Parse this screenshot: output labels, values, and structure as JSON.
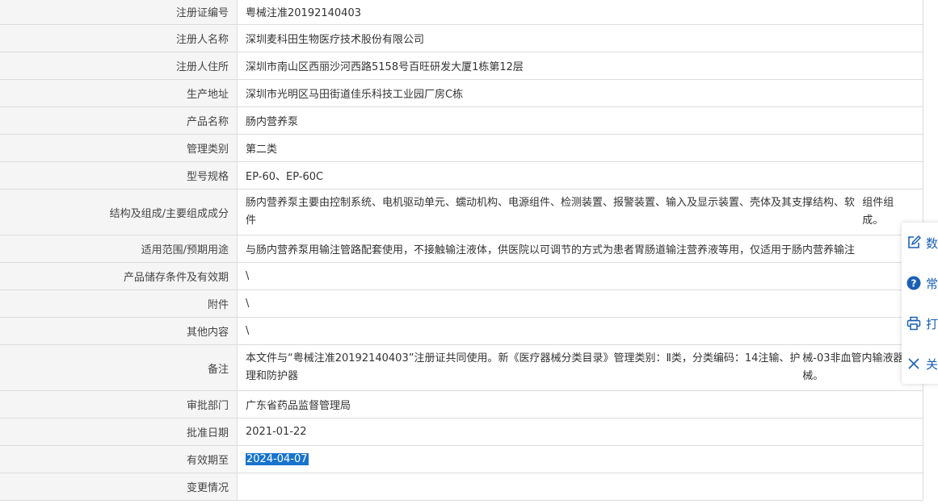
{
  "rows": [
    {
      "label": "注册证编号",
      "value": "粤械注准20192140403"
    },
    {
      "label": "注册人名称",
      "value": "深圳麦科田生物医疗技术股份有限公司"
    },
    {
      "label": "注册人住所",
      "value": "深圳市南山区西丽沙河西路5158号百旺研发大厦1栋第12层"
    },
    {
      "label": "生产地址",
      "value": "深圳市光明区马田街道佳乐科技工业园厂房C栋"
    },
    {
      "label": "产品名称",
      "value": "肠内营养泵"
    },
    {
      "label": "管理类别",
      "value": "第二类"
    },
    {
      "label": "型号规格",
      "value": "EP-60、EP-60C"
    },
    {
      "label": "结构及组成/主要组成成分",
      "value_line1": "肠内营养泵主要由控制系统、电机驱动单元、蠕动机构、电源组件、检测装置、报警装置、输入及显示装置、壳体及其支撑结构、软件",
      "value_line2": "组件组成。"
    },
    {
      "label": "适用范围/预期用途",
      "value": "与肠内营养泵用输注管路配套使用，不接触输注液体，供医院以可调节的方式为患者胃肠道输注营养液等用，仅适用于肠内营养输注"
    },
    {
      "label": "产品储存条件及有效期",
      "value": "\\"
    },
    {
      "label": "附件",
      "value": "\\"
    },
    {
      "label": "其他内容",
      "value": "\\"
    },
    {
      "label": "备注",
      "value_line1": "本文件与“粤械注准20192140403”注册证共同使用。新《医疗器械分类目录》管理类别：Ⅱ类，分类编码：14注输、护理和防护器",
      "value_line2": "械-03非血管内输液器械。"
    },
    {
      "label": "审批部门",
      "value": "广东省药品监督管理局"
    },
    {
      "label": "批准日期",
      "value": "2021-01-22"
    },
    {
      "label": "有效期至",
      "value": "2024-04-07"
    },
    {
      "label": "变更情况",
      "value": ""
    }
  ],
  "float_menu": [
    {
      "icon": "edit-icon",
      "label": "数"
    },
    {
      "icon": "help-circle-icon",
      "label": "常"
    },
    {
      "icon": "printer-icon",
      "label": "打"
    },
    {
      "icon": "close-icon",
      "label": "关"
    }
  ]
}
